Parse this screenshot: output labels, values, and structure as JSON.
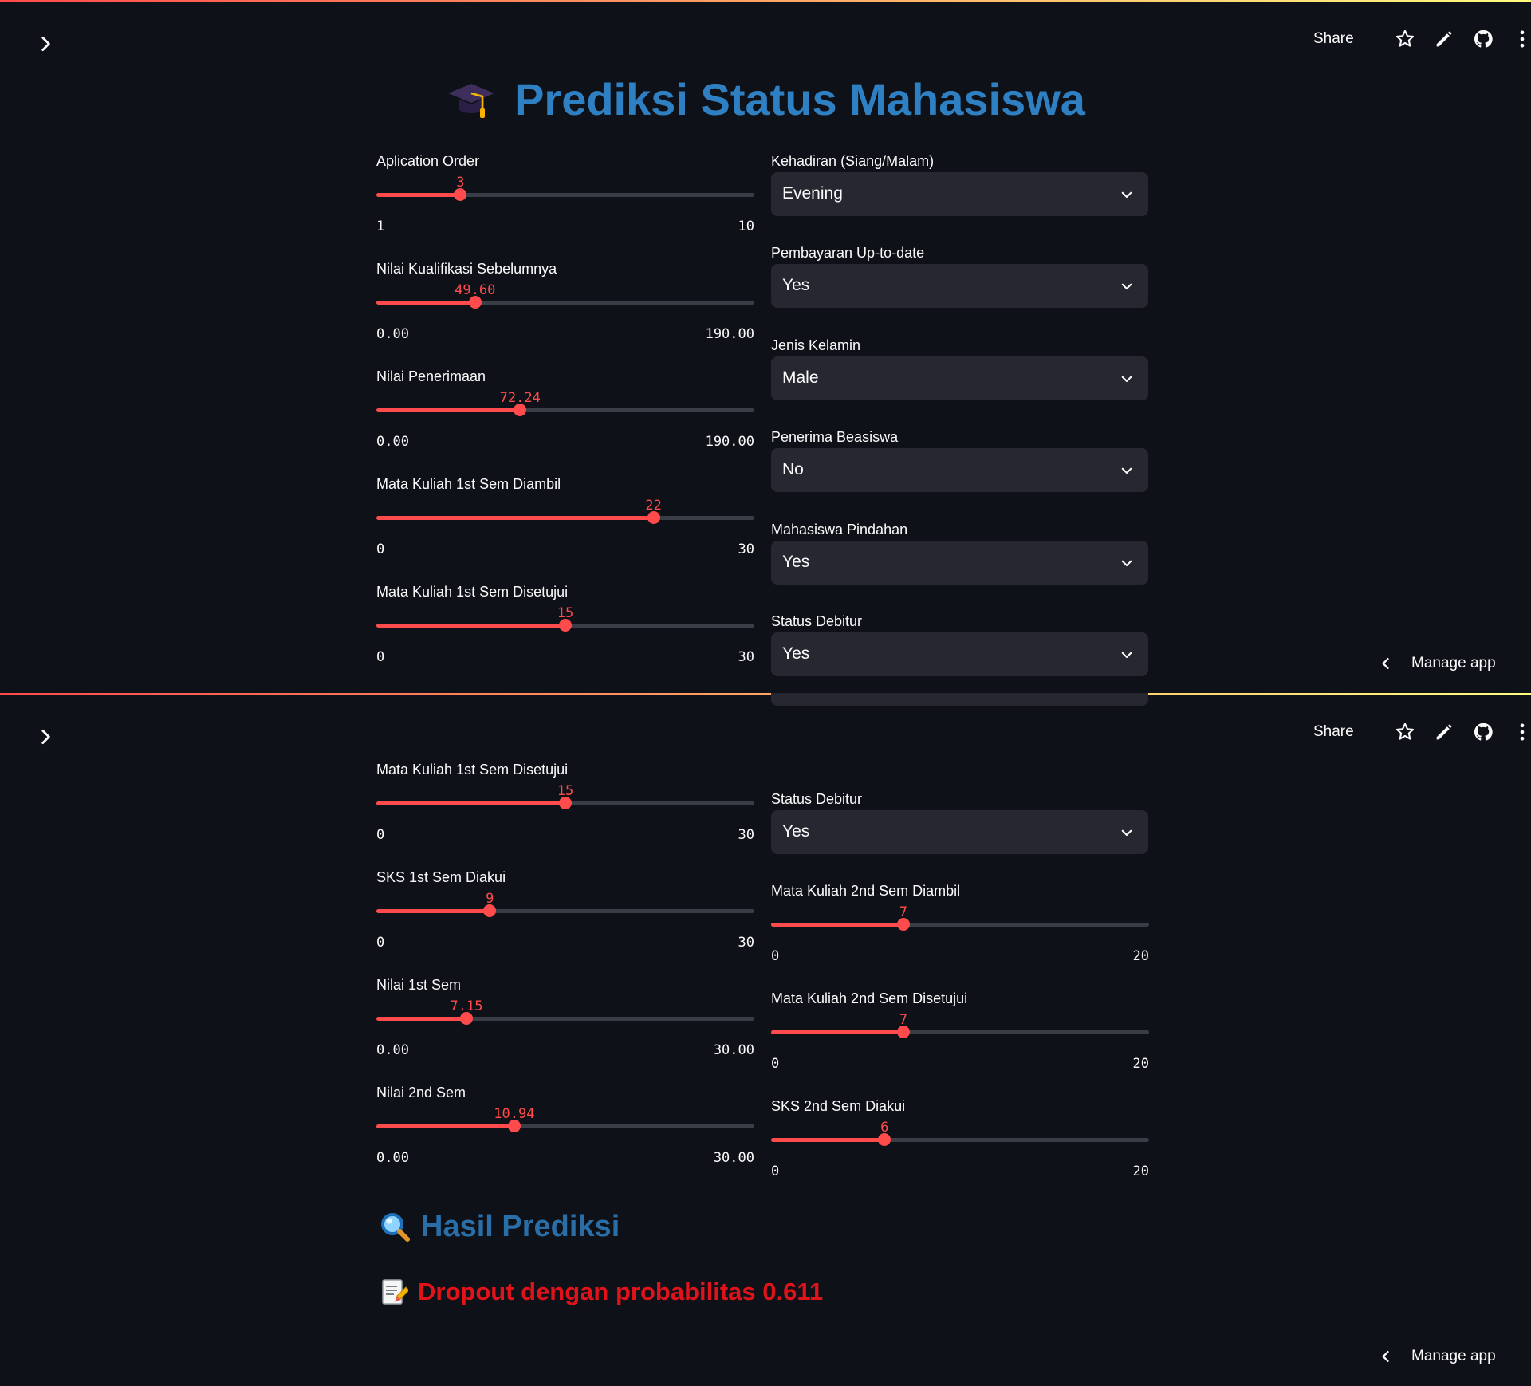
{
  "toolbar": {
    "share_label": "Share",
    "manage_label": "Manage app"
  },
  "app": {
    "title": "Prediksi Status Mahasiswa"
  },
  "top": {
    "sliders": {
      "application_order": {
        "label": "Aplication Order",
        "value": 3,
        "display": "3",
        "min": 1,
        "max": 10,
        "min_label": "1",
        "max_label": "10"
      },
      "prev_qualification": {
        "label": "Nilai Kualifikasi Sebelumnya",
        "value": 49.6,
        "display": "49.60",
        "min": 0,
        "max": 190,
        "min_label": "0.00",
        "max_label": "190.00"
      },
      "admission_grade": {
        "label": "Nilai Penerimaan",
        "value": 72.24,
        "display": "72.24",
        "min": 0,
        "max": 190,
        "min_label": "0.00",
        "max_label": "190.00"
      },
      "cu_1st_enrolled": {
        "label": "Mata Kuliah 1st Sem Diambil",
        "value": 22,
        "display": "22",
        "min": 0,
        "max": 30,
        "min_label": "0",
        "max_label": "30"
      },
      "cu_1st_approved": {
        "label": "Mata Kuliah 1st Sem Disetujui",
        "value": 15,
        "display": "15",
        "min": 0,
        "max": 30,
        "min_label": "0",
        "max_label": "30"
      }
    },
    "selects": {
      "attendance": {
        "label": "Kehadiran (Siang/Malam)",
        "value": "Evening"
      },
      "tuition": {
        "label": "Pembayaran Up-to-date",
        "value": "Yes"
      },
      "gender": {
        "label": "Jenis Kelamin",
        "value": "Male"
      },
      "scholarship": {
        "label": "Penerima Beasiswa",
        "value": "No"
      },
      "displaced": {
        "label": "Mahasiswa Pindahan",
        "value": "Yes"
      },
      "debtor": {
        "label": "Status Debitur",
        "value": "Yes"
      }
    }
  },
  "bottom": {
    "sliders": {
      "cu_1st_approved": {
        "label": "Mata Kuliah 1st Sem Disetujui",
        "value": 15,
        "display": "15",
        "min": 0,
        "max": 30,
        "min_label": "0",
        "max_label": "30"
      },
      "cu_1st_credited": {
        "label": "SKS 1st Sem Diakui",
        "value": 9,
        "display": "9",
        "min": 0,
        "max": 30,
        "min_label": "0",
        "max_label": "30"
      },
      "grade_1st": {
        "label": "Nilai 1st Sem",
        "value": 7.15,
        "display": "7.15",
        "min": 0,
        "max": 30,
        "min_label": "0.00",
        "max_label": "30.00"
      },
      "grade_2nd": {
        "label": "Nilai 2nd Sem",
        "value": 10.94,
        "display": "10.94",
        "min": 0,
        "max": 30,
        "min_label": "0.00",
        "max_label": "30.00"
      },
      "cu_2nd_enrolled": {
        "label": "Mata Kuliah 2nd Sem Diambil",
        "value": 7,
        "display": "7",
        "min": 0,
        "max": 20,
        "min_label": "0",
        "max_label": "20"
      },
      "cu_2nd_approved": {
        "label": "Mata Kuliah 2nd Sem Disetujui",
        "value": 7,
        "display": "7",
        "min": 0,
        "max": 20,
        "min_label": "0",
        "max_label": "20"
      },
      "cu_2nd_credited": {
        "label": "SKS 2nd Sem Diakui",
        "value": 6,
        "display": "6",
        "min": 0,
        "max": 20,
        "min_label": "0",
        "max_label": "20"
      }
    },
    "selects": {
      "debtor": {
        "label": "Status Debitur",
        "value": "Yes"
      }
    }
  },
  "result": {
    "heading": "Hasil Prediksi",
    "text": "Dropout dengan probabilitas 0.611"
  },
  "colors": {
    "accent": "#ff4b4b",
    "title": "#2f80c2",
    "result_heading": "#2a6ea8",
    "result_text": "#e1131a",
    "background": "#0e1117",
    "widget": "#262730"
  },
  "icons": [
    "chevron-right-icon",
    "star-icon",
    "pencil-icon",
    "github-icon",
    "kebab-menu-icon",
    "chevron-left-icon",
    "graduation-cap-icon",
    "chevron-down-icon",
    "magnifier-icon",
    "memo-icon"
  ]
}
